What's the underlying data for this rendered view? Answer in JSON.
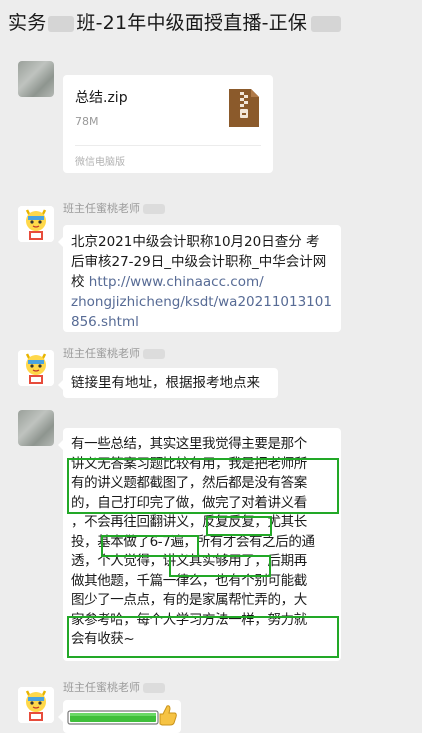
{
  "header": {
    "title_prefix": "实务",
    "title_suffix": "班-21年中级面授直播-正保"
  },
  "messages": {
    "file": {
      "name": "总结.zip",
      "size": "78M",
      "source": "微信电脑版"
    },
    "msg2": {
      "sender": "班主任蜜桃老师",
      "text_lines": [
        "北京2021中级会计职称10月20日查分 考",
        "后审核27-29日_中级会计职称_中华会计网",
        "校 "
      ],
      "link_lines": [
        "http://www.chinaacc.com/",
        "zhongjizhicheng/ksdt/wa20211013101",
        "856.shtml"
      ],
      "link_first_inline": "http://www.chinaacc.com/"
    },
    "msg3": {
      "sender": "班主任蜜桃老师",
      "text": "链接里有地址，根据报考地点来"
    },
    "msg4": {
      "lines": [
        "有一些总结，其实这里我觉得主要是那个",
        "讲义无答案习题比较有用，我是把老师所",
        "有的讲义题都截图了，然后都是没有答案",
        "的，自己打印完了做，做完了对着讲义看",
        "，不会再往回翻讲义，反复反复，尤其长",
        "投，基本做了6-7遍，所有才会有之后的通",
        "透，个人觉得，讲义其实够用了，后期再",
        "做其他题，千篇一律么，也有个别可能截",
        "图少了一点点，有的是家属帮忙弄的，大",
        "家参考哈，每个人学习方法一样，努力就",
        "会有收获~"
      ]
    },
    "msg5": {
      "sender": "班主任蜜桃老师",
      "emoji": "progress-bar-thumbs-up"
    }
  },
  "colors": {
    "background": "#ededed",
    "bubble": "#ffffff",
    "link": "#576b95",
    "highlight": "#22a827",
    "zip_icon": "#8b5a2b"
  }
}
